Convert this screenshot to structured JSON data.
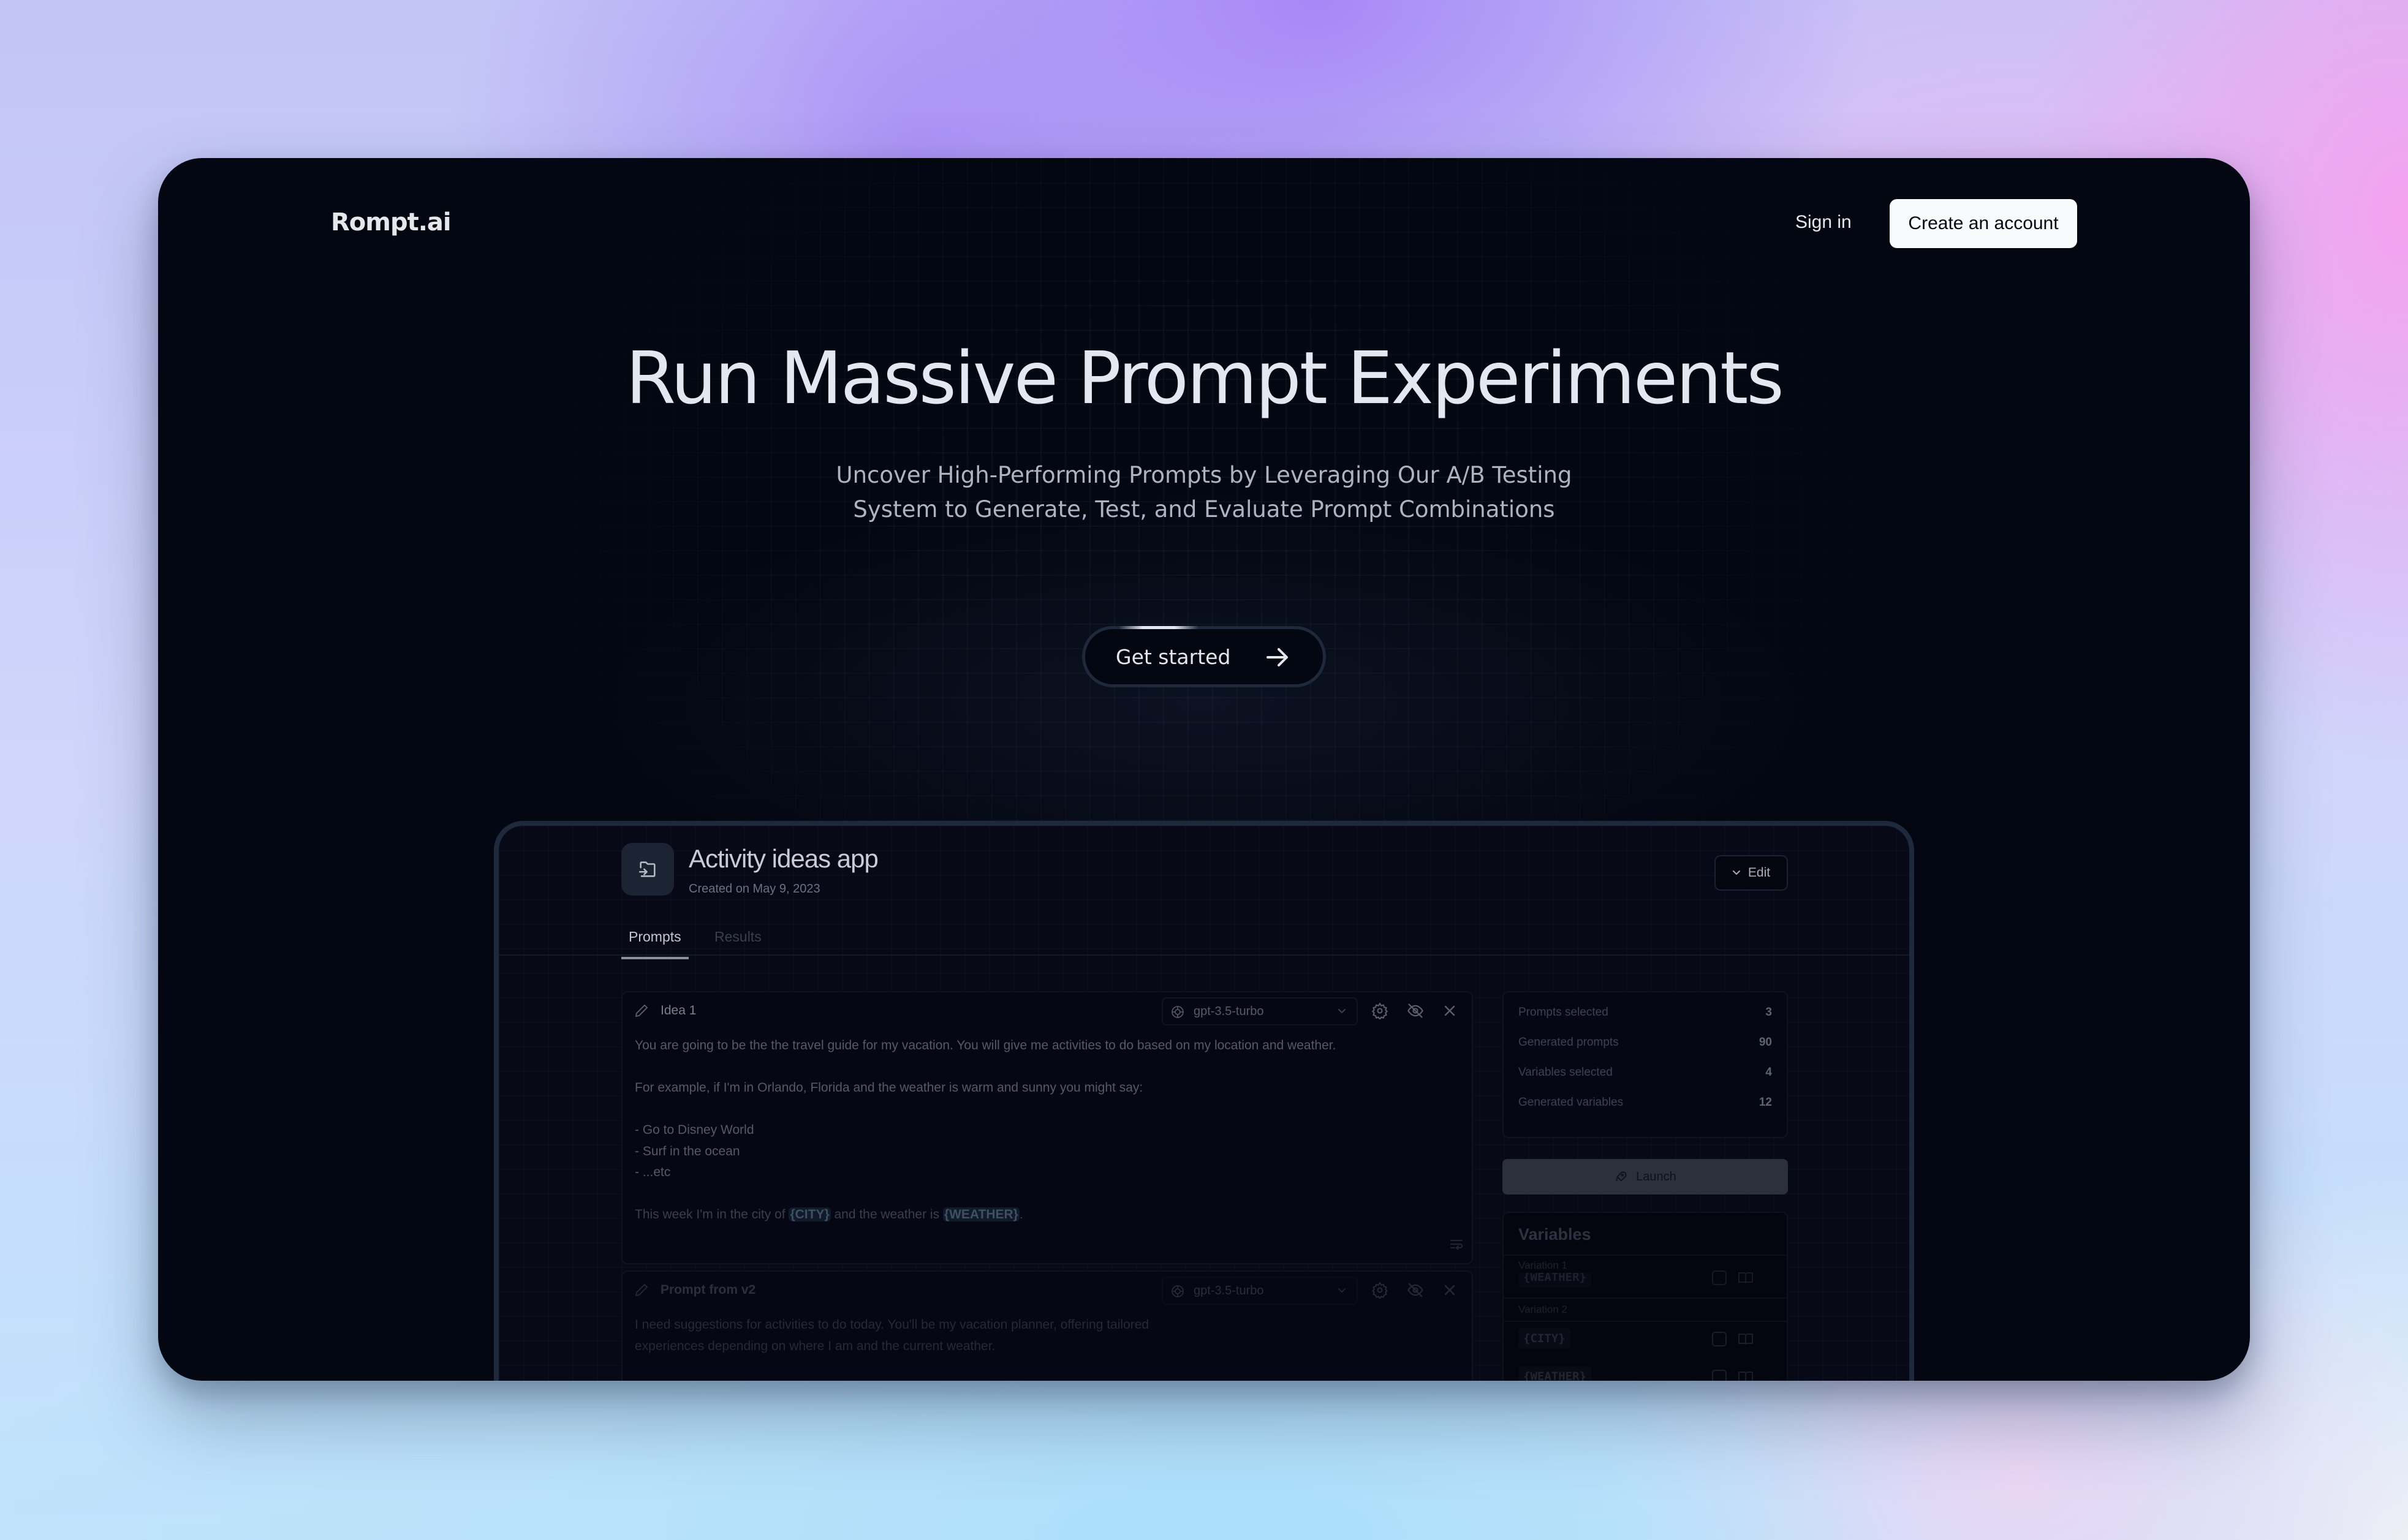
{
  "brand": {
    "name": "Rompt.ai"
  },
  "nav": {
    "sign_in": "Sign in",
    "create_account": "Create an account"
  },
  "hero": {
    "title": "Run Massive Prompt Experiments",
    "subtitle_line1": "Uncover High-Performing Prompts by Leveraging Our A/B Testing",
    "subtitle_line2": "System to Generate, Test, and Evaluate Prompt Combinations",
    "cta_label": "Get started",
    "cta_icon": "arrow-right-icon"
  },
  "preview": {
    "project_icon": "folder-import-icon",
    "project_title": "Activity ideas app",
    "created": "Created on May 9, 2023",
    "edit_label": "Edit",
    "tabs": [
      {
        "label": "Prompts",
        "active": true
      },
      {
        "label": "Results",
        "active": false
      }
    ],
    "prompts": [
      {
        "name": "Idea 1",
        "model": "gpt-3.5-turbo",
        "lines": [
          "You are going to be the the travel guide for my vacation. You will give me activities to do based on my location and weather.",
          "",
          "For example, if I'm in Orlando, Florida and the weather is warm and sunny you might say:",
          "",
          "- Go to Disney World",
          "- Surf in the ocean",
          "- ...etc",
          ""
        ],
        "final_line": {
          "before": "This week I'm in the city of ",
          "var1": "{CITY}",
          "middle": " and the weather is ",
          "var2": "{WEATHER}",
          "after": "."
        }
      },
      {
        "name": "Prompt from v2",
        "model": "gpt-3.5-turbo",
        "lines": [
          "I need suggestions for activities to do today. You'll be my vacation planner, offering tailored",
          "experiences depending on where I am and the current weather."
        ]
      }
    ],
    "stats": [
      {
        "label": "Prompts selected",
        "value": "3"
      },
      {
        "label": "Generated prompts",
        "value": "90"
      },
      {
        "label": "Variables selected",
        "value": "4"
      },
      {
        "label": "Generated variables",
        "value": "12"
      }
    ],
    "launch_label": "Launch",
    "variables": {
      "title": "Variables",
      "variation1_label": "Variation 1",
      "variation1_tag": "{WEATHER}",
      "variation2_label": "Variation 2",
      "variation2_tags": [
        "{CITY}",
        "{WEATHER}"
      ]
    }
  }
}
